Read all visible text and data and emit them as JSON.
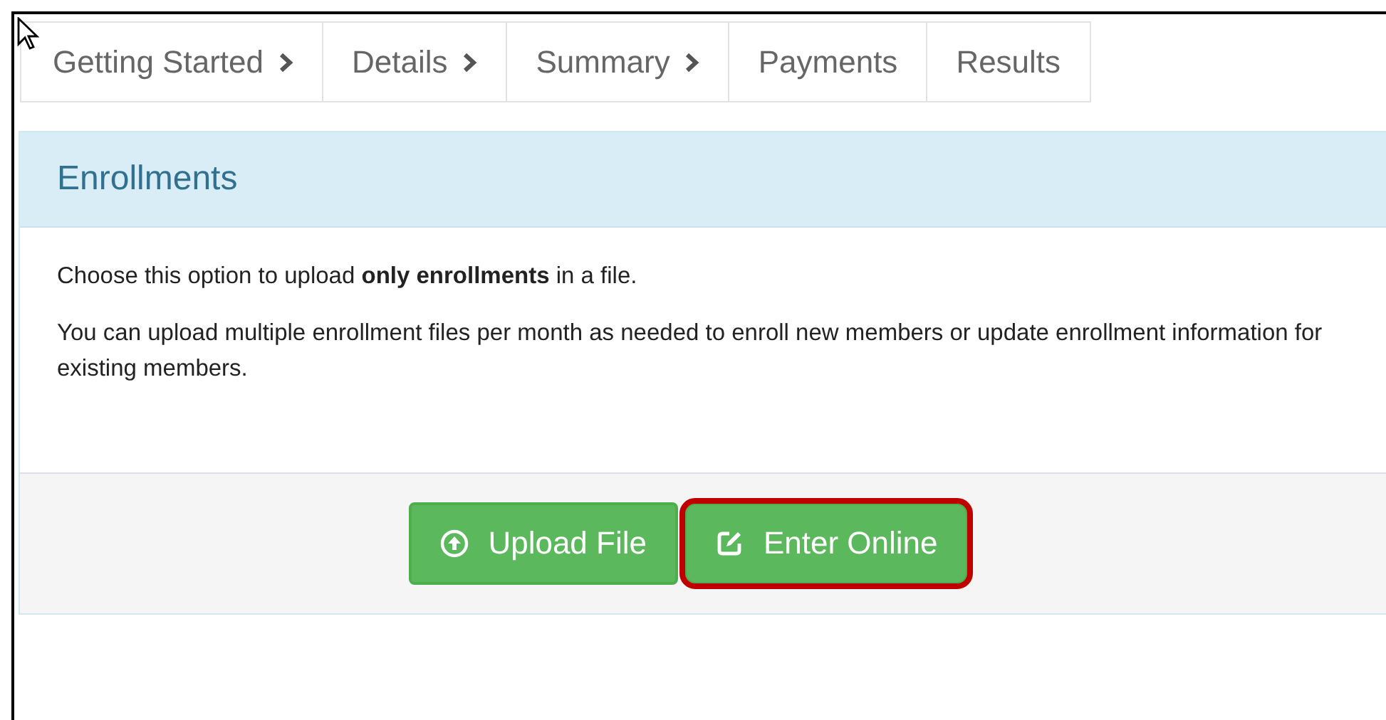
{
  "tabs": [
    {
      "label": "Getting Started",
      "chevron": true
    },
    {
      "label": "Details",
      "chevron": true
    },
    {
      "label": "Summary",
      "chevron": true
    },
    {
      "label": "Payments",
      "chevron": false
    },
    {
      "label": "Results",
      "chevron": false
    }
  ],
  "panel": {
    "title": "Enrollments",
    "paragraphs": [
      "Choose this option to upload **only enrollments** in a file.",
      "You can upload multiple enrollment files per month as needed to enroll new members or update enrollment information for existing members."
    ],
    "buttons": [
      {
        "label": "Upload File",
        "kind": "upload",
        "highlighted": false
      },
      {
        "label": "Enter Online",
        "kind": "edit",
        "highlighted": true
      }
    ]
  }
}
